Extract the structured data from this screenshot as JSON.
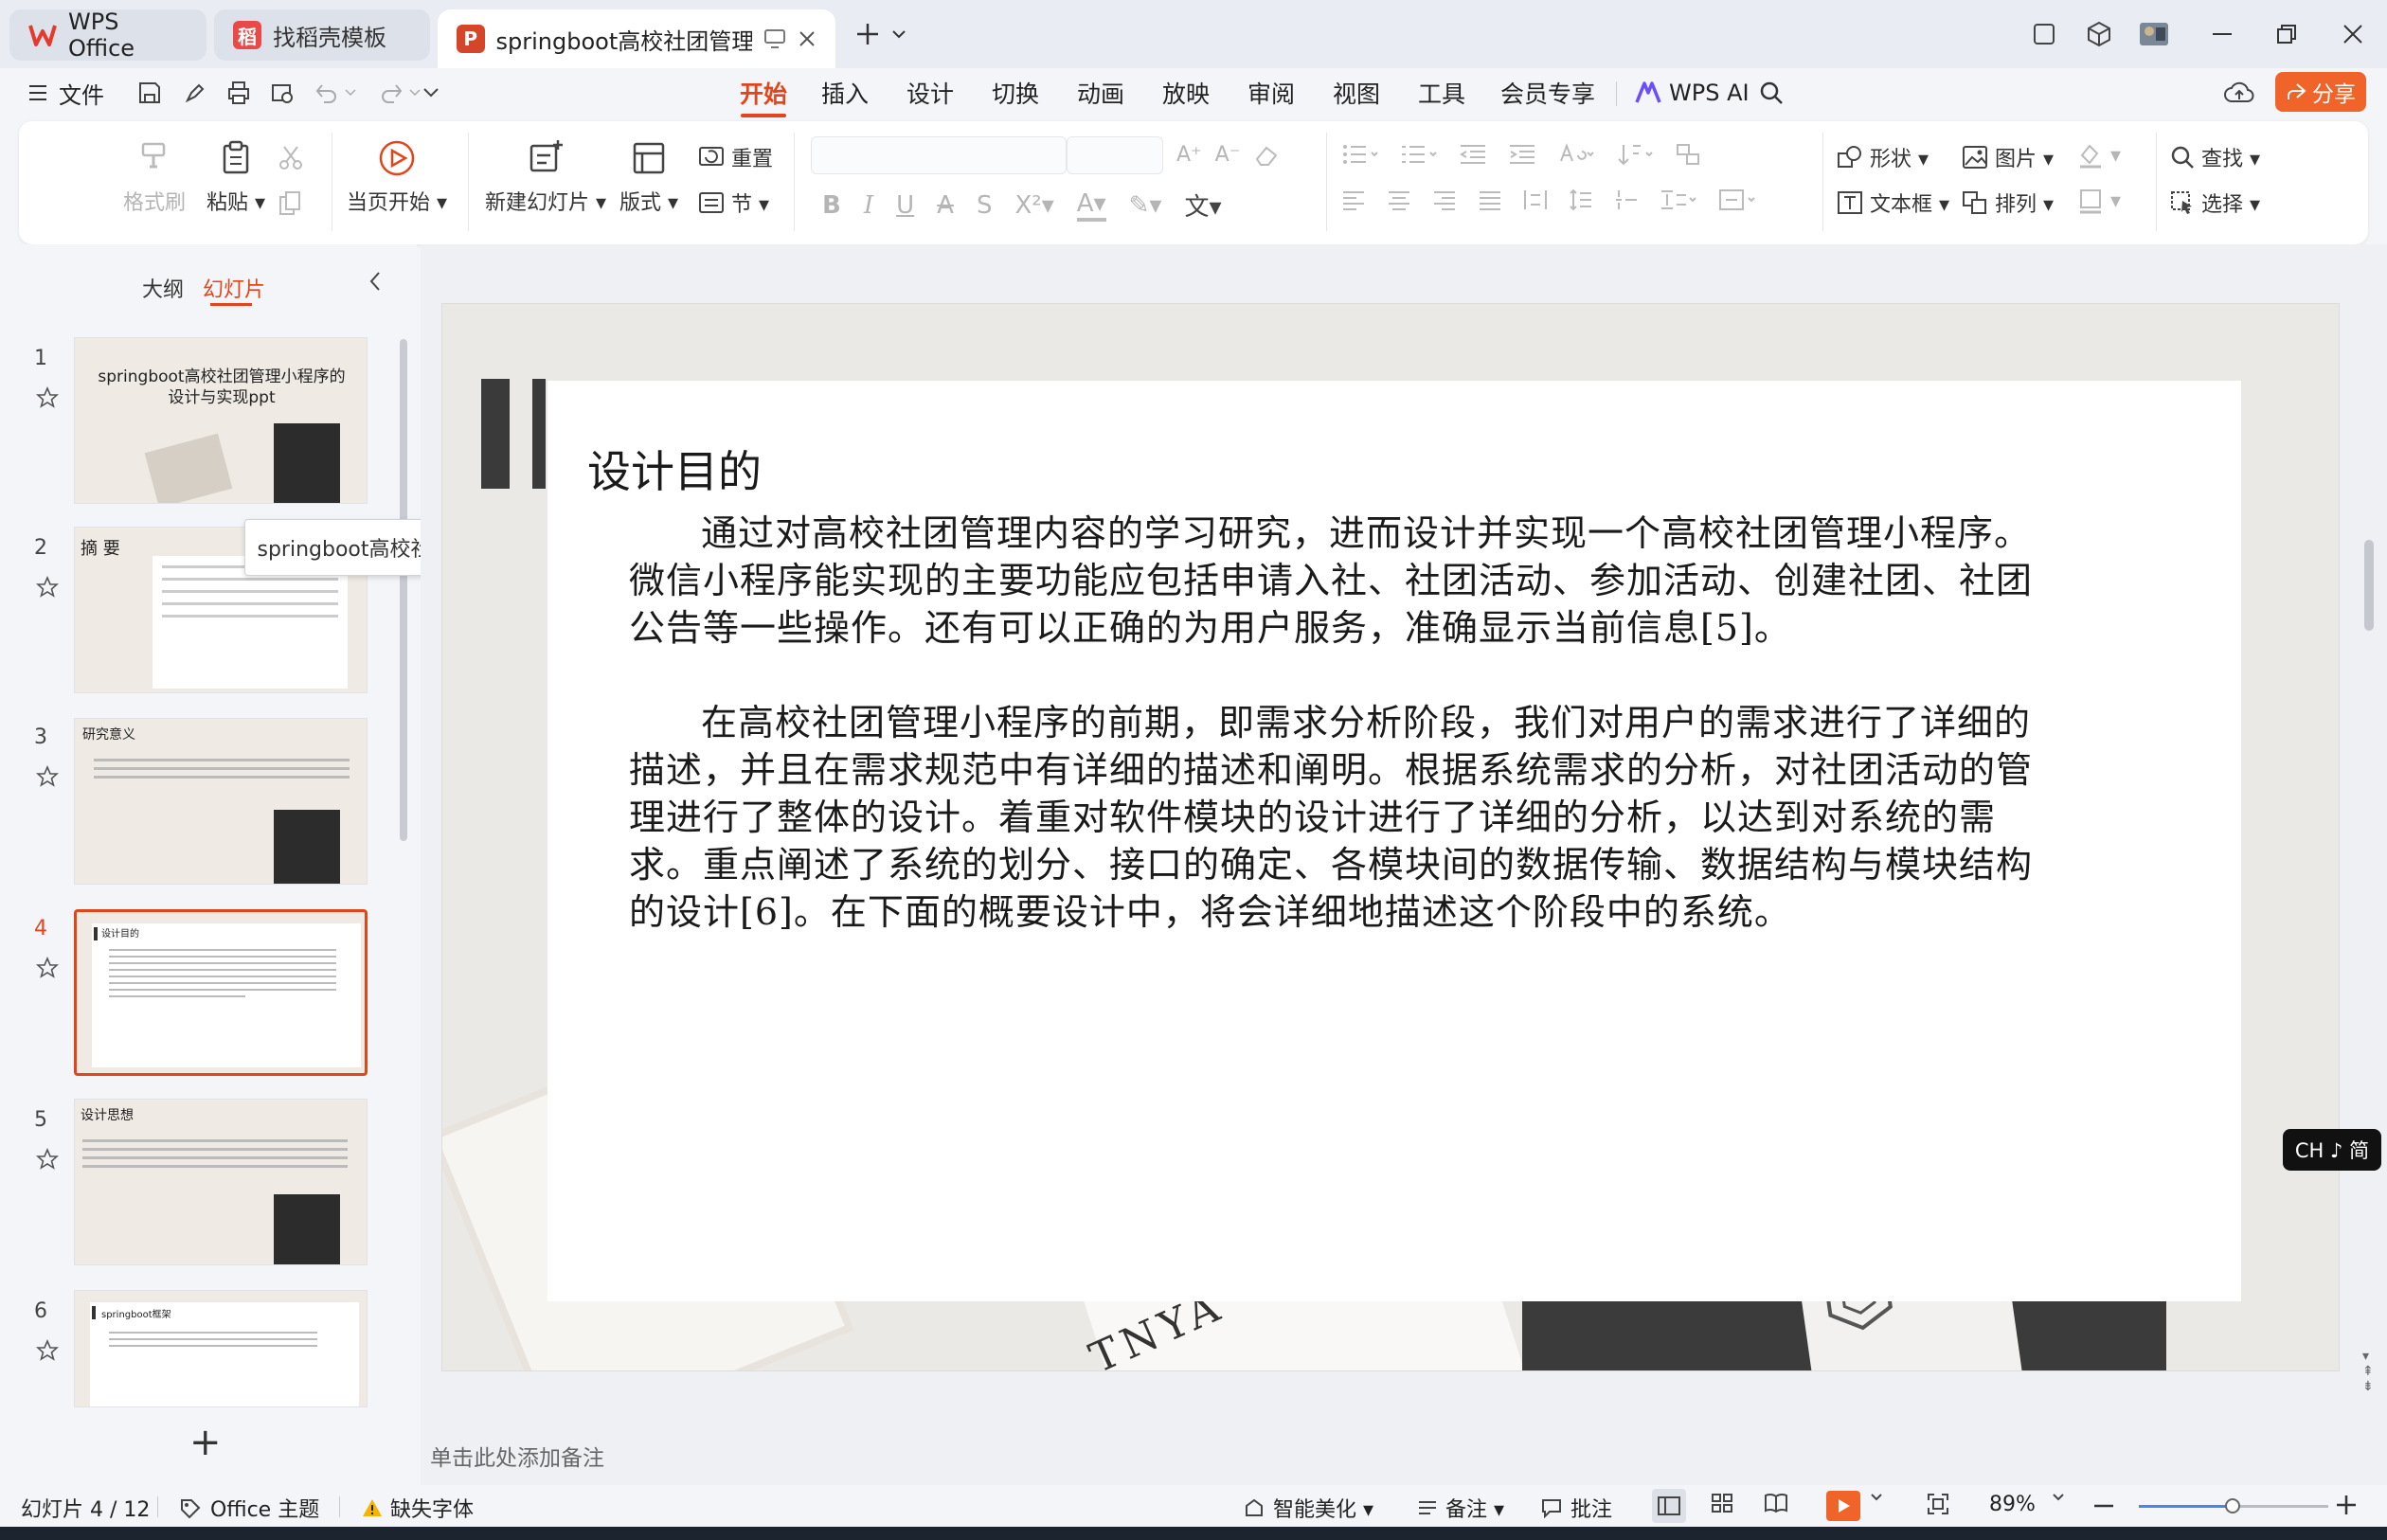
{
  "tabs": [
    {
      "label": "WPS Office",
      "icon": "wps-logo-icon"
    },
    {
      "label": "找稻壳模板",
      "icon": "docer-icon"
    },
    {
      "label": "springboot高校社团管理小程",
      "icon": "presentation-file-icon"
    }
  ],
  "menu": {
    "file_label": "文件",
    "tabs": [
      "开始",
      "插入",
      "设计",
      "切换",
      "动画",
      "放映",
      "审阅",
      "视图",
      "工具",
      "会员专享"
    ],
    "wps_ai": "WPS AI",
    "share": "分享"
  },
  "ribbon": {
    "format_painter": "格式刷",
    "paste": "粘贴",
    "from_current": "当页开始",
    "new_slide": "新建幻灯片",
    "layout": "版式",
    "reset": "重置",
    "section": "节",
    "shape": "形状",
    "picture": "图片",
    "find": "查找",
    "textbox": "文本框",
    "arrange": "排列",
    "select": "选择"
  },
  "panel": {
    "outline_tab": "大纲",
    "slides_tab": "幻灯片",
    "tooltip": "springboot高校社...",
    "thumbs": [
      {
        "num": "1",
        "title": "springboot高校社团管理小程序的设计与实现ppt"
      },
      {
        "num": "2",
        "title": "摘 要"
      },
      {
        "num": "3",
        "title": "研究意义"
      },
      {
        "num": "4",
        "title": "设计目的"
      },
      {
        "num": "5",
        "title": "设计思想"
      },
      {
        "num": "6",
        "title": "springboot框架"
      }
    ],
    "add_label": "+"
  },
  "slide": {
    "title": "设计目的",
    "paragraphs": [
      "通过对高校社团管理内容的学习研究，进而设计并实现一个高校社团管理小程序。微信小程序能实现的主要功能应包括申请入社、社团活动、参加活动、创建社团、社团公告等一些操作。还有可以正确的为用户服务，准确显示当前信息[5]。",
      "在高校社团管理小程序的前期，即需求分析阶段，我们对用户的需求进行了详细的描述，并且在需求规范中有详细的描述和阐明。根据系统需求的分析，对社团活动的管理进行了整体的设计。着重对软件模块的设计进行了详细的分析，以达到对系统的需求。重点阐述了系统的划分、接口的确定、各模块间的数据传输、数据结构与模块结构的设计[6]。在下面的概要设计中，将会详细地描述这个阶段中的系统。"
    ],
    "bg_text": "TNYA"
  },
  "ime": "CH ♪ 简",
  "notes_placeholder": "单击此处添加备注",
  "status": {
    "slide_counter": "幻灯片 4 / 12",
    "theme": "Office 主题",
    "missing_font": "缺失字体",
    "beautify": "智能美化",
    "notes": "备注",
    "comments": "批注",
    "zoom": "89%",
    "zoom_level": 0.5
  },
  "colors": {
    "accent": "#e2451a",
    "share_bg": "#f0642a"
  }
}
